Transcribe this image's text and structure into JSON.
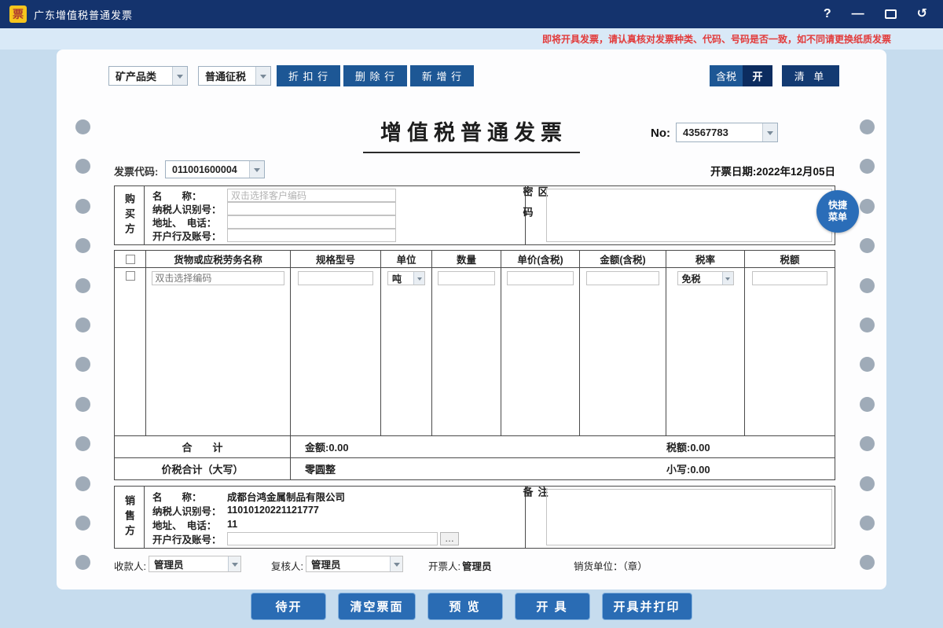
{
  "titlebar": {
    "logo_text": "票",
    "title": "广东增值税普通发票",
    "help_icon": "?",
    "minimize_icon": "—",
    "undo_icon": "↺"
  },
  "warning_text": "即将开具发票，请认真核对发票种类、代码、号码是否一致，如不同请更换纸质发票",
  "toolbar": {
    "category_value": "矿产品类",
    "tax_mode_value": "普通征税",
    "discount_row": "折 扣 行",
    "delete_row": "删 除 行",
    "add_row": "新 增 行",
    "tax_included_label": "含税",
    "tax_included_state": "开",
    "list_button": "清 单"
  },
  "invoice": {
    "title": "增值税普通发票",
    "no_label": "No:",
    "no_value": "43567783",
    "code_label": "发票代码:",
    "code_value": "011001600004",
    "date_text": "开票日期:2022年12月05日",
    "quick_menu": "快捷菜单"
  },
  "buyer": {
    "side_label": "购买方",
    "name_label": "名　　称：",
    "name_placeholder": "双击选择客户编码",
    "tax_id_label": "纳税人识别号：",
    "address_label": "地址、　电话：",
    "bank_label": "开户行及账号：",
    "password_label": "密码区"
  },
  "items": {
    "headers": [
      "货物或应税劳务名称",
      "规格型号",
      "单位",
      "数量",
      "单价(含税)",
      "金额(含税)",
      "税率",
      "税额"
    ],
    "row1": {
      "name_placeholder": "双击选择编码",
      "unit_value": "吨",
      "tax_rate_value": "免税"
    }
  },
  "totals": {
    "subtotal_label": "合　　计",
    "amount_text": "金额:0.00",
    "tax_text": "税额:0.00",
    "grand_label": "价税合计（大写）",
    "words_text": "零圆整",
    "numeric_text": "小写:0.00"
  },
  "seller": {
    "side_label": "销售方",
    "name_label": "名　　称：",
    "name_value": "成都台鸿金属制品有限公司",
    "tax_id_label": "纳税人识别号：",
    "tax_id_value": "11010120221121777",
    "address_label": "地址、　电话：",
    "address_value": "11",
    "bank_label": "开户行及账号：",
    "more_button": "…",
    "remark_label": "备注"
  },
  "footer": {
    "payee_label": "收款人:",
    "payee_value": "管理员",
    "reviewer_label": "复核人:",
    "reviewer_value": "管理员",
    "drawer_label": "开票人:",
    "drawer_value": "管理员",
    "stamp_label": "销货单位：（章）"
  },
  "actions": [
    "待开",
    "清空票面",
    "预 览",
    "开 具",
    "开具并打印"
  ],
  "colors": {
    "titlebar": "#14336d",
    "toolbar_blue": "#1d5795",
    "dark_navy": "#0c2c5f",
    "action_blue": "#2a6cb4",
    "warning_red": "#e23b3b",
    "background": "#c6dcee"
  }
}
